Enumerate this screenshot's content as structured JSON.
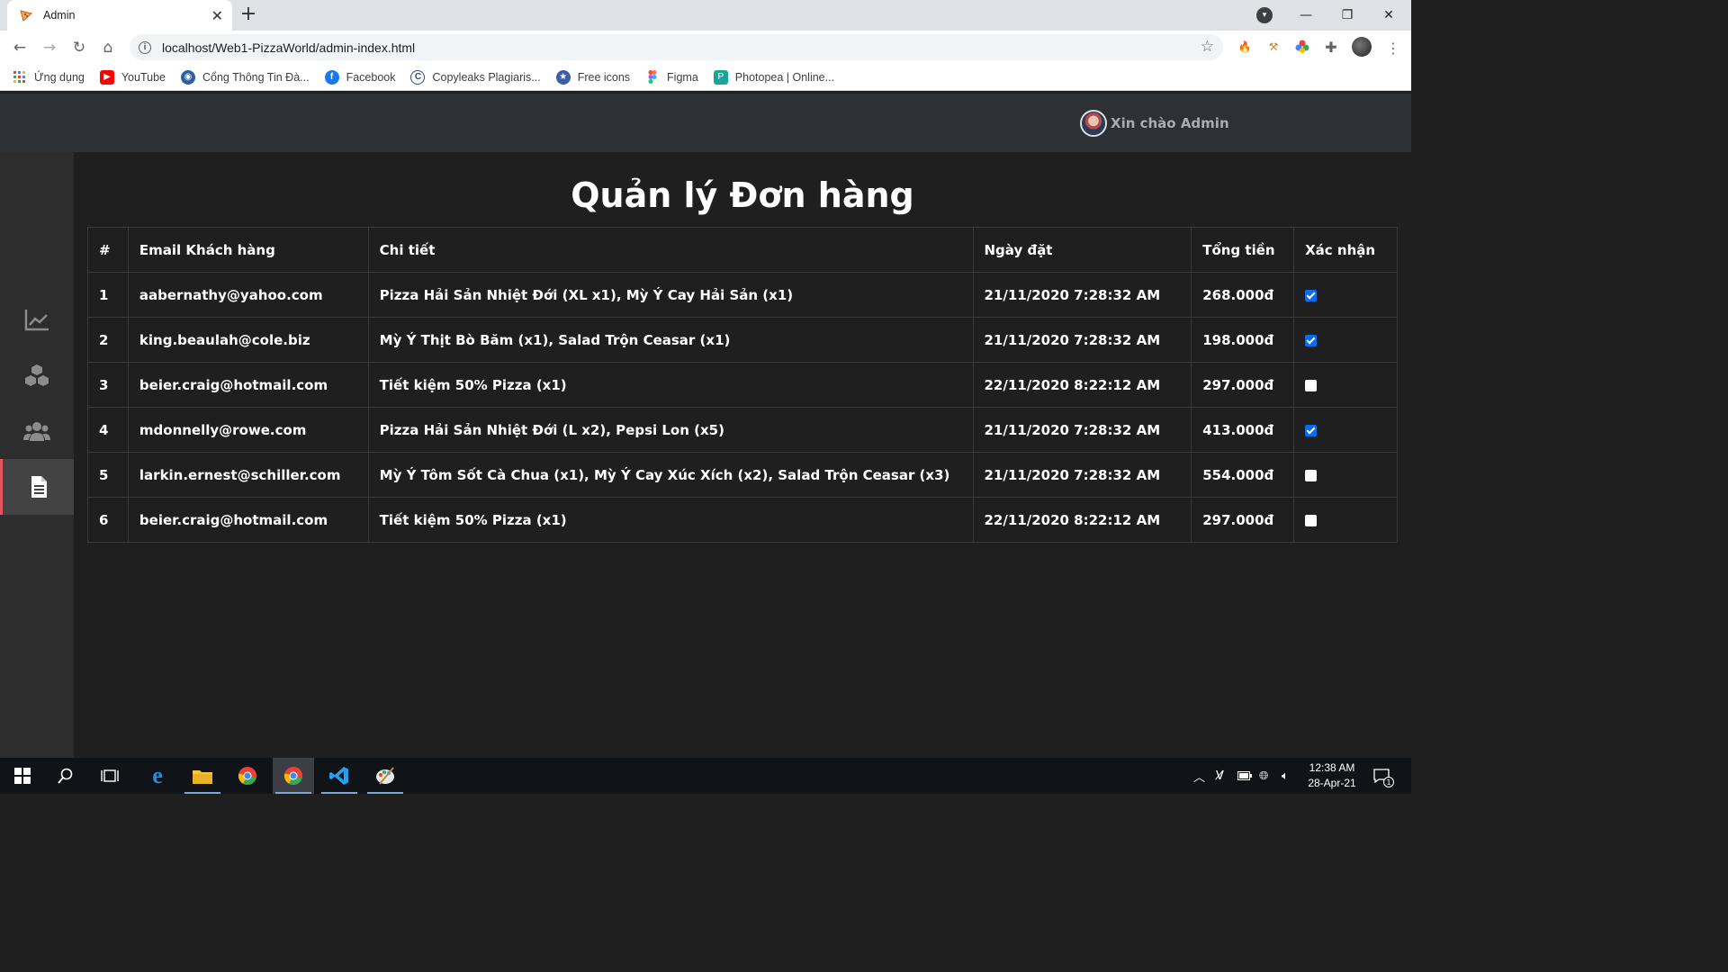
{
  "browser": {
    "tab_title": "Admin",
    "url": "localhost/Web1-PizzaWorld/admin-index.html",
    "bookmarks": [
      {
        "label": "Ứng dụng",
        "icon": "apps-grid-icon",
        "color": "#e8453c"
      },
      {
        "label": "YouTube",
        "icon": "youtube-icon",
        "color": "#ff0000"
      },
      {
        "label": "Cổng Thông Tin Đà...",
        "icon": "portal-icon",
        "color": "#2a5ea8"
      },
      {
        "label": "Facebook",
        "icon": "facebook-icon",
        "color": "#1877f2"
      },
      {
        "label": "Copyleaks Plagiaris...",
        "icon": "copyleaks-icon",
        "color": "#2b4a7a"
      },
      {
        "label": "Free icons",
        "icon": "free-icons-icon",
        "color": "#3d5ea8"
      },
      {
        "label": "Figma",
        "icon": "figma-icon",
        "color": "#f24e1e"
      },
      {
        "label": "Photopea | Online...",
        "icon": "photopea-icon",
        "color": "#18a497"
      }
    ]
  },
  "header": {
    "greeting": "Xin chào Admin"
  },
  "sidebar": {
    "items": [
      {
        "name": "statistics",
        "icon": "chart-line-icon",
        "active": false
      },
      {
        "name": "products",
        "icon": "boxes-icon",
        "active": false
      },
      {
        "name": "users",
        "icon": "users-icon",
        "active": false
      },
      {
        "name": "orders",
        "icon": "document-icon",
        "active": true
      }
    ]
  },
  "main": {
    "title": "Quản lý Đơn hàng",
    "columns": [
      "#",
      "Email Khách hàng",
      "Chi tiết",
      "Ngày đặt",
      "Tổng tiền",
      "Xác nhận"
    ],
    "rows": [
      {
        "id": "1",
        "email": "aabernathy@yahoo.com",
        "detail": "Pizza Hải Sản Nhiệt Đới (XL x1), Mỳ Ý Cay Hải Sản (x1)",
        "date": "21/11/2020 7:28:32 AM",
        "total": "268.000đ",
        "confirmed": true
      },
      {
        "id": "2",
        "email": "king.beaulah@cole.biz",
        "detail": "Mỳ Ý Thịt Bò Băm (x1), Salad Trộn Ceasar (x1)",
        "date": "21/11/2020 7:28:32 AM",
        "total": "198.000đ",
        "confirmed": true
      },
      {
        "id": "3",
        "email": "beier.craig@hotmail.com",
        "detail": "Tiết kiệm 50% Pizza (x1)",
        "date": "22/11/2020 8:22:12 AM",
        "total": "297.000đ",
        "confirmed": false
      },
      {
        "id": "4",
        "email": "mdonnelly@rowe.com",
        "detail": "Pizza Hải Sản Nhiệt Đới (L x2), Pepsi Lon (x5)",
        "date": "21/11/2020 7:28:32 AM",
        "total": "413.000đ",
        "confirmed": true
      },
      {
        "id": "5",
        "email": "larkin.ernest@schiller.com",
        "detail": "Mỳ Ý Tôm Sốt Cà Chua (x1), Mỳ Ý Cay Xúc Xích (x2), Salad Trộn Ceasar (x3)",
        "date": "21/11/2020 7:28:32 AM",
        "total": "554.000đ",
        "confirmed": false
      },
      {
        "id": "6",
        "email": "beier.craig@hotmail.com",
        "detail": "Tiết kiệm 50% Pizza (x1)",
        "date": "22/11/2020 8:22:12 AM",
        "total": "297.000đ",
        "confirmed": false
      }
    ]
  },
  "taskbar": {
    "time": "12:38 AM",
    "date": "28-Apr-21",
    "notification_count": "1"
  },
  "colors": {
    "accent": "#e25563",
    "checkbox": "#0b6cf0",
    "header_bg": "#2d3035",
    "sidebar_bg": "#2d2d2d",
    "main_bg": "#1f1f1f"
  }
}
